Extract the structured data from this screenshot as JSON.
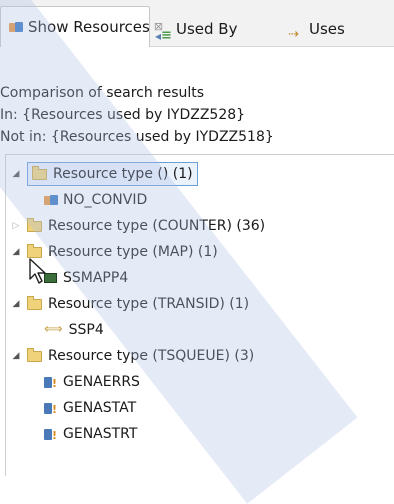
{
  "tabs": [
    {
      "label": "Show Resources",
      "close": "⊠",
      "icon": "resources-icon",
      "active": true
    },
    {
      "label": "Used By",
      "icon": "used-by-icon",
      "active": false
    },
    {
      "label": "Uses",
      "icon": "uses-icon",
      "active": false
    }
  ],
  "summary": {
    "line1": "Comparison of search results",
    "line2": "In: {Resources used by IYDZZ528}",
    "line3": "Not in: {Resources used by IYDZZ518}"
  },
  "tree": [
    {
      "label": "Resource type ()  (1)",
      "expanded": true,
      "selected": true,
      "children": [
        {
          "label": "NO_CONVID",
          "icon": "resource-icon"
        }
      ]
    },
    {
      "label": "Resource type (COUNTER)  (36)",
      "expanded": false,
      "children": []
    },
    {
      "label": "Resource type (MAP)  (1)",
      "expanded": true,
      "children": [
        {
          "label": "SSMAPP4",
          "icon": "screen-icon"
        }
      ]
    },
    {
      "label": "Resource type (TRANSID)  (1)",
      "expanded": true,
      "children": [
        {
          "label": "SSP4",
          "icon": "transaction-icon"
        }
      ]
    },
    {
      "label": "Resource type (TSQUEUE)  (3)",
      "expanded": true,
      "children": [
        {
          "label": "GENAERRS",
          "icon": "queue-icon"
        },
        {
          "label": "GENASTAT",
          "icon": "queue-icon"
        },
        {
          "label": "GENASTRT",
          "icon": "queue-icon"
        }
      ]
    }
  ],
  "colors": {
    "selection_border": "#6a9fd8",
    "watermark": "#afbee6"
  }
}
